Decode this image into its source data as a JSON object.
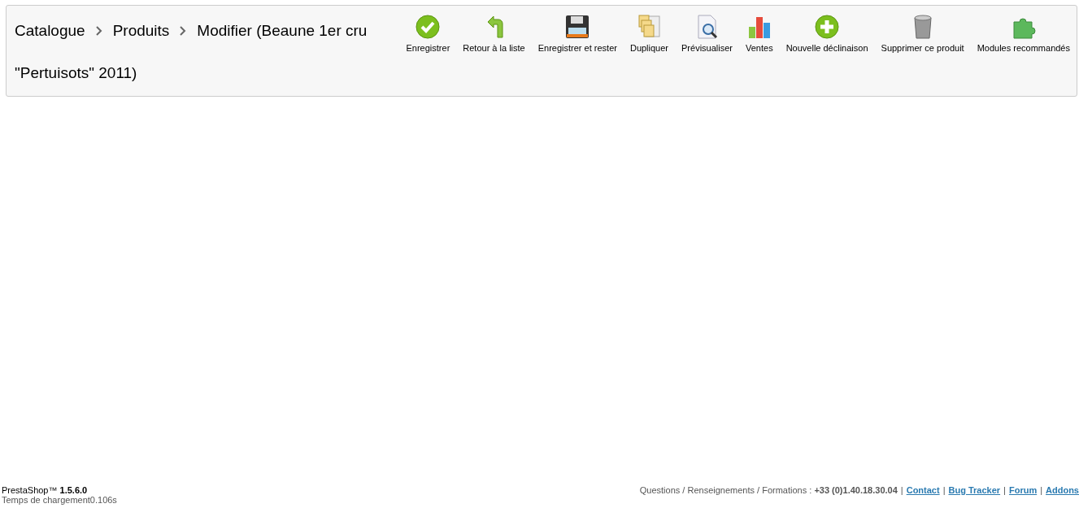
{
  "breadcrumb": [
    "Catalogue",
    "Produits",
    "Modifier (Beaune 1er cru"
  ],
  "title_continued": "\"Pertuisots\" 2011)",
  "toolbar": [
    {
      "kind": "check",
      "label": "Enregistrer"
    },
    {
      "kind": "back",
      "label": "Retour à la liste"
    },
    {
      "kind": "save",
      "label": "Enregistrer et rester"
    },
    {
      "kind": "duplicate",
      "label": "Dupliquer"
    },
    {
      "kind": "preview",
      "label": "Prévisualiser"
    },
    {
      "kind": "stats",
      "label": "Ventes"
    },
    {
      "kind": "add",
      "label": "Nouvelle déclinaison"
    },
    {
      "kind": "trash",
      "label": "Supprimer ce produit"
    },
    {
      "kind": "puzzle",
      "label": "Modules recommandés"
    }
  ],
  "footer": {
    "version": "PrestaShop™ **1.5.6.0**",
    "load_time": "Temps de chargement0.106s",
    "contact_text": "Questions / Renseignements / Formations : **+33 (0)1.40.18.30.04**",
    "separator": "|",
    "links": [
      "Contact",
      "Bug Tracker",
      "Forum",
      "Addons"
    ]
  }
}
